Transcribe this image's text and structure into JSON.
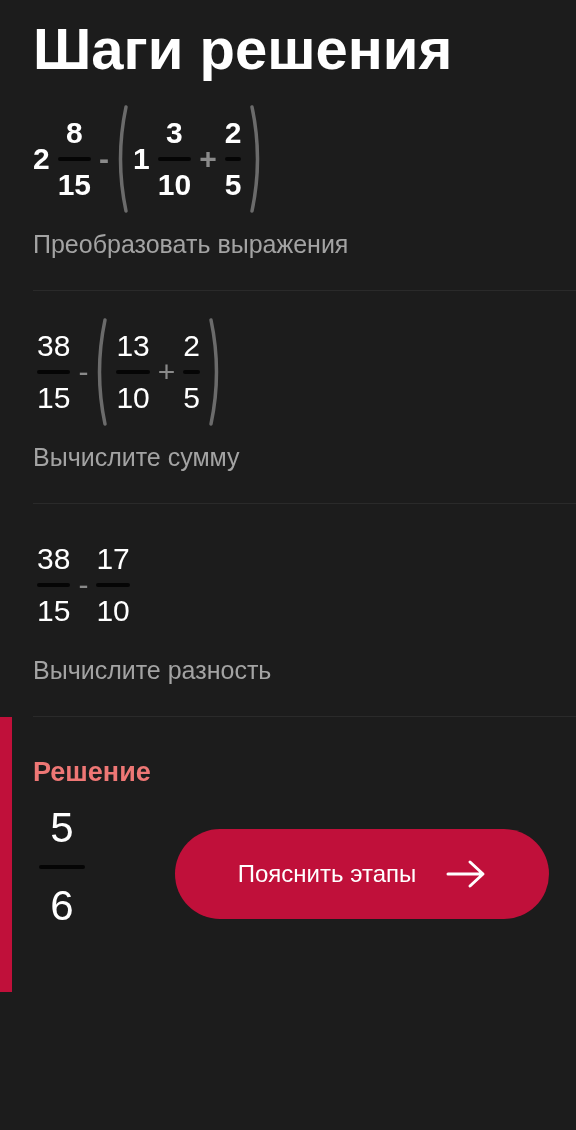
{
  "title": "Шаги решения",
  "steps": [
    {
      "bold": true,
      "expression": [
        {
          "kind": "int",
          "text": "2"
        },
        {
          "kind": "frac",
          "num": "8",
          "den": "15"
        },
        {
          "kind": "op",
          "text": "-"
        },
        {
          "kind": "group",
          "children": [
            {
              "kind": "int",
              "text": "1"
            },
            {
              "kind": "frac",
              "num": "3",
              "den": "10"
            },
            {
              "kind": "op",
              "text": "+"
            },
            {
              "kind": "frac",
              "num": "2",
              "den": "5"
            }
          ]
        }
      ],
      "label": "Преобразовать выражения"
    },
    {
      "bold": false,
      "expression": [
        {
          "kind": "frac",
          "num": "38",
          "den": "15"
        },
        {
          "kind": "op",
          "text": "-"
        },
        {
          "kind": "group",
          "children": [
            {
              "kind": "frac",
              "num": "13",
              "den": "10"
            },
            {
              "kind": "op",
              "text": "+"
            },
            {
              "kind": "frac",
              "num": "2",
              "den": "5"
            }
          ]
        }
      ],
      "label": "Вычислите сумму"
    },
    {
      "bold": false,
      "expression": [
        {
          "kind": "frac",
          "num": "38",
          "den": "15"
        },
        {
          "kind": "op",
          "text": "-"
        },
        {
          "kind": "frac",
          "num": "17",
          "den": "10"
        }
      ],
      "label": "Вычислите разность"
    }
  ],
  "solution": {
    "heading": "Решение",
    "answer": {
      "num": "5",
      "den": "6"
    },
    "button": "Пояснить этапы"
  }
}
